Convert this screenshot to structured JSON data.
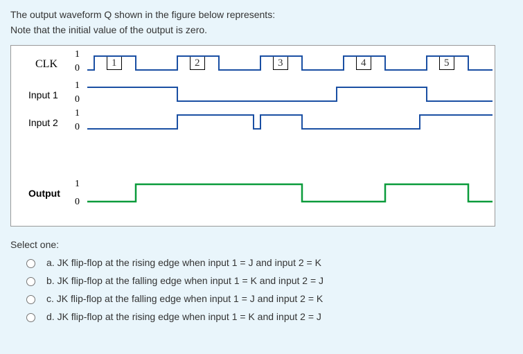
{
  "question": {
    "line1": "The output waveform Q shown in the figure below represents:",
    "line2": "Note that the initial value of the output is zero."
  },
  "diagram": {
    "clk_label": "CLK",
    "input1_label": "Input 1",
    "input2_label": "Input 2",
    "output_label": "Output",
    "level_hi": "1",
    "level_lo": "0",
    "cycle_labels": [
      "1",
      "2",
      "3",
      "4",
      "5"
    ]
  },
  "select_one": "Select one:",
  "options": {
    "a": "a. JK flip-flop at the rising edge when input 1 = J and input 2 = K",
    "b": "b. JK flip-flop at the falling edge when input 1 = K and input 2 = J",
    "c": "c. JK flip-flop at the falling edge when input 1 = J and input 2 = K",
    "d": "d. JK flip-flop at the rising edge when input 1 = K and input 2 = J"
  }
}
